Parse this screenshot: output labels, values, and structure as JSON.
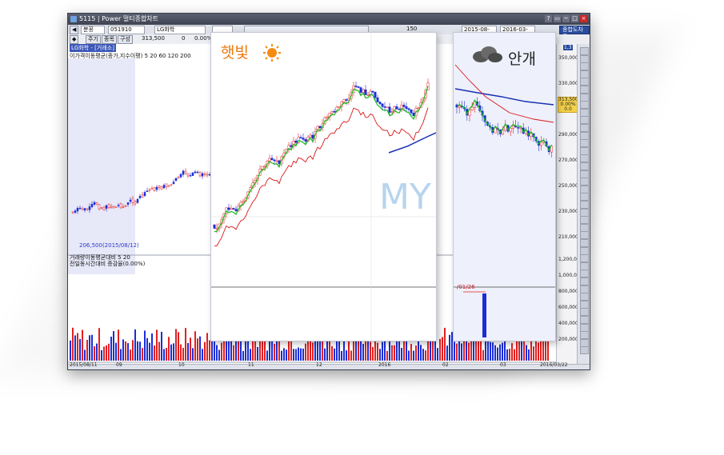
{
  "window": {
    "title": "5115 | Power 멀티종합차트",
    "controls": [
      "?",
      "▭",
      "─",
      "□",
      "×"
    ]
  },
  "toolbar": {
    "market_select": "분꽁",
    "stock_code": "051910",
    "stock_name": "LG화학",
    "period_buttons": [
      "주기",
      "종목",
      "구성"
    ],
    "price_value": "313,500",
    "change_value": "0",
    "change_pct": "0.00%",
    "date_from": "2015-08-11",
    "date_to": "2016-03-22",
    "view_mode_button": "종합도차트",
    "page_count": "150"
  },
  "chart": {
    "panel_title": "LG화학 - [거래소]",
    "ma_legend": "이가격이동평균(종가,지수이평) 5 20 60 120 200",
    "low_marker": "206,500(2015/08/12)",
    "volume_title": "거래량이동평균대비 5 20",
    "volume_sub": "전일동시간대비 증감율(0.00%)",
    "volume_marker": "/01/26",
    "watermark": "MY",
    "right_tag": "1,3",
    "y_axis_price": [
      "350,000",
      "330,000",
      "310,000",
      "290,000",
      "270,000",
      "250,000",
      "230,000",
      "210,000"
    ],
    "y_axis_volume": [
      "1,200,000",
      "1,000,000",
      "800,000",
      "600,000",
      "400,000",
      "200,000"
    ],
    "current_price_tag": [
      "313,500",
      "0.00%",
      "0.0"
    ],
    "x_axis": [
      "2015/08/11",
      "09",
      "10",
      "11",
      "12",
      "2016",
      "02",
      "03",
      "2016/03/22"
    ]
  },
  "overlays": {
    "sunny_label": "햇빛",
    "cloudy_label": "안개"
  },
  "colors": {
    "up": "#e32020",
    "down": "#1a2ed8",
    "ma5": "#18b818",
    "ma20": "#d81818",
    "ma60": "#1830b0",
    "sun": "#f28c14",
    "label_orange": "#ee7a10",
    "label_dark": "#222222"
  }
}
